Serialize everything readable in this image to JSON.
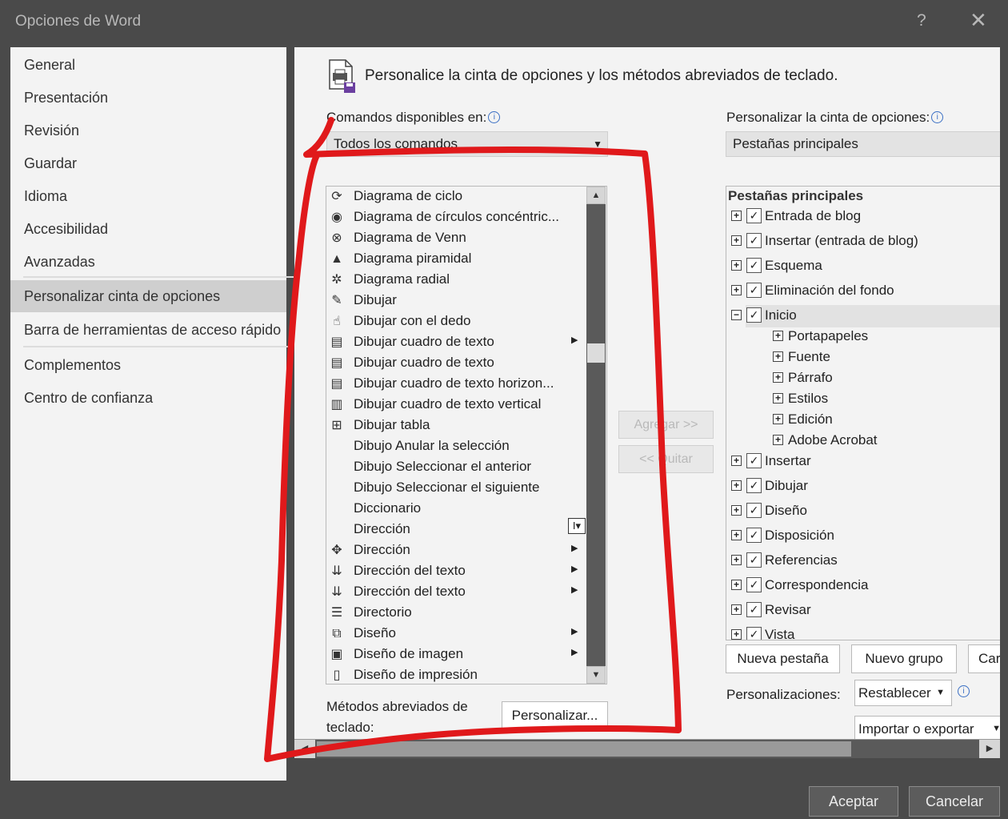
{
  "window": {
    "title": "Opciones de Word",
    "help_glyph": "?",
    "close_glyph": "✕"
  },
  "nav": {
    "items": [
      {
        "label": "General"
      },
      {
        "label": "Presentación"
      },
      {
        "label": "Revisión"
      },
      {
        "label": "Guardar"
      },
      {
        "label": "Idioma"
      },
      {
        "label": "Accesibilidad"
      },
      {
        "label": "Avanzadas"
      },
      {
        "label": "Personalizar cinta de opciones"
      },
      {
        "label": "Barra de herramientas de acceso rápido"
      },
      {
        "label": "Complementos"
      },
      {
        "label": "Centro de confianza"
      }
    ]
  },
  "main": {
    "heading": "Personalice la cinta de opciones y los métodos abreviados de teclado.",
    "commands_label": "Comandos disponibles en:",
    "commands_selected": "Todos los comandos",
    "ribbon_label": "Personalizar la cinta de opciones:",
    "ribbon_selected": "Pestañas principales",
    "commands": [
      {
        "label": "Diagrama de ciclo",
        "icon": "⟳",
        "has_submenu": false
      },
      {
        "label": "Diagrama de círculos concéntric...",
        "icon": "◉",
        "has_submenu": false
      },
      {
        "label": "Diagrama de Venn",
        "icon": "⊗",
        "has_submenu": false
      },
      {
        "label": "Diagrama piramidal",
        "icon": "▲",
        "has_submenu": false
      },
      {
        "label": "Diagrama radial",
        "icon": "✲",
        "has_submenu": false
      },
      {
        "label": "Dibujar",
        "icon": "✎",
        "has_submenu": false
      },
      {
        "label": "Dibujar con el dedo",
        "icon": "☝",
        "has_submenu": false
      },
      {
        "label": "Dibujar cuadro de texto",
        "icon": "▤",
        "has_submenu": true
      },
      {
        "label": "Dibujar cuadro de texto",
        "icon": "▤",
        "has_submenu": false
      },
      {
        "label": "Dibujar cuadro de texto horizon...",
        "icon": "▤",
        "has_submenu": false
      },
      {
        "label": "Dibujar cuadro de texto vertical",
        "icon": "▥",
        "has_submenu": false
      },
      {
        "label": "Dibujar tabla",
        "icon": "⊞",
        "has_submenu": false
      },
      {
        "label": "Dibujo Anular la selección",
        "icon": "",
        "has_submenu": false
      },
      {
        "label": "Dibujo Seleccionar el anterior",
        "icon": "",
        "has_submenu": false
      },
      {
        "label": "Dibujo Seleccionar el siguiente",
        "icon": "",
        "has_submenu": false
      },
      {
        "label": "Diccionario",
        "icon": "",
        "has_submenu": false
      },
      {
        "label": "Dirección",
        "icon": "",
        "has_submenu": false
      },
      {
        "label": "Dirección",
        "icon": "✥",
        "has_submenu": true
      },
      {
        "label": "Dirección del texto",
        "icon": "⇊",
        "has_submenu": true
      },
      {
        "label": "Dirección del texto",
        "icon": "⇊",
        "has_submenu": true
      },
      {
        "label": "Directorio",
        "icon": "☰",
        "has_submenu": false
      },
      {
        "label": "Diseño",
        "icon": "⧉",
        "has_submenu": true
      },
      {
        "label": "Diseño de imagen",
        "icon": "▣",
        "has_submenu": true
      },
      {
        "label": "Diseño de impresión",
        "icon": "▯",
        "has_submenu": false
      }
    ],
    "add_button": "Agregar >>",
    "remove_button": "<< Quitar",
    "shortcut_label_line1": "Métodos abreviados de",
    "shortcut_label_line2": "teclado:",
    "customize_button": "Personalizar...",
    "tree_header": "Pestañas principales",
    "tree": [
      {
        "label": "Entrada de blog",
        "level": 0,
        "expander": "+",
        "checked": true
      },
      {
        "label": "Insertar (entrada de blog)",
        "level": 0,
        "expander": "+",
        "checked": true
      },
      {
        "label": "Esquema",
        "level": 0,
        "expander": "+",
        "checked": true
      },
      {
        "label": "Eliminación del fondo",
        "level": 0,
        "expander": "+",
        "checked": true
      },
      {
        "label": "Inicio",
        "level": 0,
        "expander": "−",
        "checked": true,
        "selected": true
      },
      {
        "label": "Portapapeles",
        "level": 1,
        "expander": "+"
      },
      {
        "label": "Fuente",
        "level": 1,
        "expander": "+"
      },
      {
        "label": "Párrafo",
        "level": 1,
        "expander": "+"
      },
      {
        "label": "Estilos",
        "level": 1,
        "expander": "+"
      },
      {
        "label": "Edición",
        "level": 1,
        "expander": "+"
      },
      {
        "label": "Adobe Acrobat",
        "level": 1,
        "expander": "+"
      },
      {
        "label": "Insertar",
        "level": 0,
        "expander": "+",
        "checked": true
      },
      {
        "label": "Dibujar",
        "level": 0,
        "expander": "+",
        "checked": true
      },
      {
        "label": "Diseño",
        "level": 0,
        "expander": "+",
        "checked": true
      },
      {
        "label": "Disposición",
        "level": 0,
        "expander": "+",
        "checked": true
      },
      {
        "label": "Referencias",
        "level": 0,
        "expander": "+",
        "checked": true
      },
      {
        "label": "Correspondencia",
        "level": 0,
        "expander": "+",
        "checked": true
      },
      {
        "label": "Revisar",
        "level": 0,
        "expander": "+",
        "checked": true
      },
      {
        "label": "Vista",
        "level": 0,
        "expander": "+",
        "checked": true
      }
    ],
    "new_tab_button": "Nueva pestaña",
    "new_group_button": "Nuevo grupo",
    "rename_button_partial": "Car",
    "customizations_label": "Personalizaciones:",
    "reset_button": "Restablecer",
    "import_export_button": "Importar o exportar"
  },
  "footer": {
    "ok": "Aceptar",
    "cancel": "Cancelar"
  },
  "annotation_color": "#e0191b"
}
